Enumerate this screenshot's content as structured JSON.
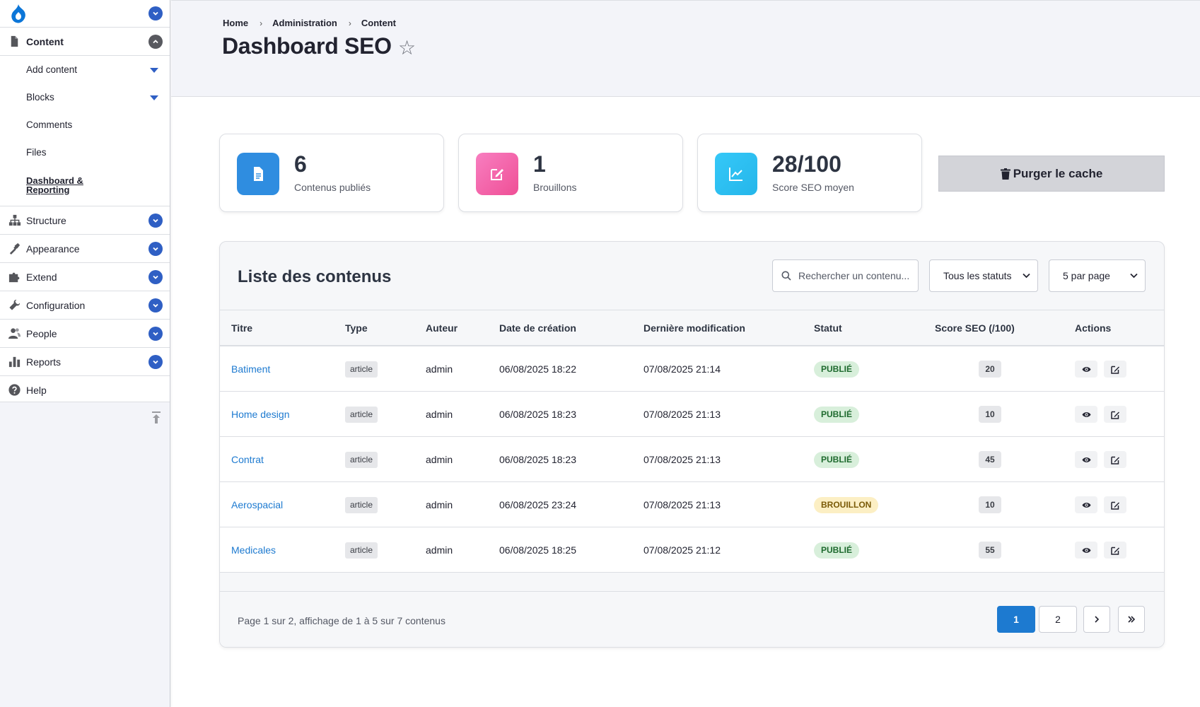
{
  "sidebar": {
    "sections": {
      "content": "Content",
      "structure": "Structure",
      "appearance": "Appearance",
      "extend": "Extend",
      "configuration": "Configuration",
      "people": "People",
      "reports": "Reports",
      "help": "Help"
    },
    "content_children": {
      "add_content": "Add content",
      "blocks": "Blocks",
      "comments": "Comments",
      "files": "Files",
      "dashboard": "Dashboard & Reporting"
    }
  },
  "breadcrumb": [
    "Home",
    "Administration",
    "Content"
  ],
  "page_title": "Dashboard SEO",
  "star_icon": "☆",
  "stats": [
    {
      "value": "6",
      "label": "Contenus publiés",
      "icon": "document-icon",
      "color": "#2f8de0"
    },
    {
      "value": "1",
      "label": "Brouillons",
      "icon": "edit-icon",
      "color": "#f0569e"
    },
    {
      "value": "28/100",
      "label": "Score SEO moyen",
      "icon": "chart-line-icon",
      "color": "#2bc3f2"
    }
  ],
  "purge_button": "Purger le cache",
  "list": {
    "title": "Liste des contenus",
    "search_placeholder": "Rechercher un contenu...",
    "status_filter": "Tous les statuts",
    "per_page": "5 par page",
    "columns": [
      "Titre",
      "Type",
      "Auteur",
      "Date de création",
      "Dernière modification",
      "Statut",
      "Score SEO (/100)",
      "Actions"
    ],
    "rows": [
      {
        "title": "Batiment",
        "type": "article",
        "author": "admin",
        "created": "06/08/2025 18:22",
        "modified": "07/08/2025 21:14",
        "status": "PUBLIÉ",
        "status_kind": "published",
        "score": 20
      },
      {
        "title": "Home design",
        "type": "article",
        "author": "admin",
        "created": "06/08/2025 18:23",
        "modified": "07/08/2025 21:13",
        "status": "PUBLIÉ",
        "status_kind": "published",
        "score": 10
      },
      {
        "title": "Contrat",
        "type": "article",
        "author": "admin",
        "created": "06/08/2025 18:23",
        "modified": "07/08/2025 21:13",
        "status": "PUBLIÉ",
        "status_kind": "published",
        "score": 45
      },
      {
        "title": "Aerospacial",
        "type": "article",
        "author": "admin",
        "created": "06/08/2025 23:24",
        "modified": "07/08/2025 21:13",
        "status": "BROUILLON",
        "status_kind": "draft",
        "score": 10
      },
      {
        "title": "Medicales",
        "type": "article",
        "author": "admin",
        "created": "06/08/2025 18:25",
        "modified": "07/08/2025 21:12",
        "status": "PUBLIÉ",
        "status_kind": "published",
        "score": 55
      }
    ],
    "footer_text": "Page 1 sur 2, affichage de 1 à 5 sur 7 contenus",
    "pagination": {
      "pages": [
        "1",
        "2"
      ],
      "current": "1"
    }
  }
}
